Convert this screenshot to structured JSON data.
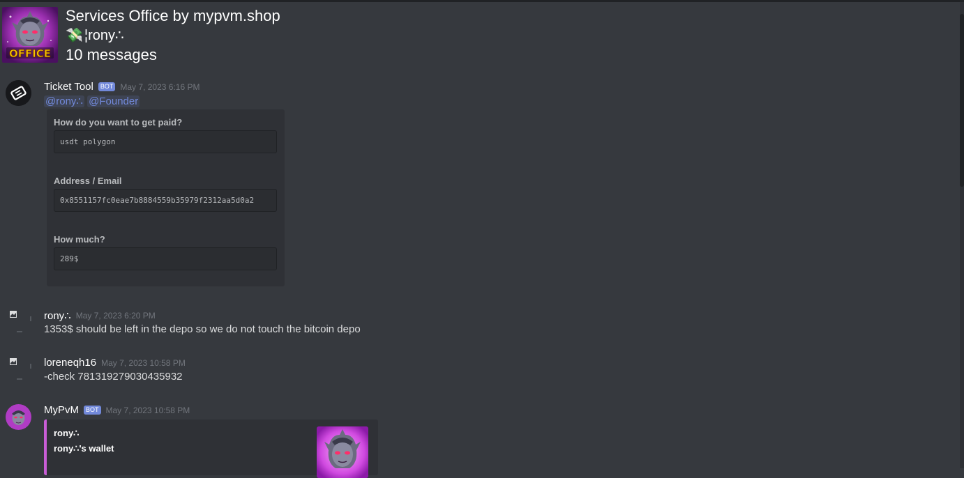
{
  "header": {
    "guild_name": "Services Office by mypvm.shop",
    "channel_emoji": "💸",
    "channel_name": "¦rony∴",
    "message_count": "10 messages",
    "guild_icon_text": "OFFICE"
  },
  "messages": [
    {
      "author": "Ticket Tool",
      "bot_tag": "BOT",
      "timestamp": "May 7, 2023 6:16 PM",
      "mentions": [
        "@rony∴",
        "@Founder"
      ],
      "embed": {
        "fields": [
          {
            "label": "How do you want to get paid?",
            "value": "usdt polygon"
          },
          {
            "label": "Address / Email",
            "value": "0x8551157fc0eae7b8884559b35979f2312aa5d0a2"
          },
          {
            "label": "How much?",
            "value": "289$"
          }
        ]
      }
    },
    {
      "author": "rony∴",
      "timestamp": "May 7, 2023 6:20 PM",
      "content": "1353$ should be left in the depo so we do not touch the bitcoin depo"
    },
    {
      "author": "loreneqh16",
      "timestamp": "May 7, 2023 10:58 PM",
      "content": "-check 781319279030435932"
    },
    {
      "author": "MyPvM",
      "bot_tag": "BOT",
      "timestamp": "May 7, 2023 10:58 PM",
      "embed": {
        "title": "rony∴",
        "subtitle": "rony∴'s wallet",
        "accent_color": "#c95dd6"
      }
    }
  ],
  "colors": {
    "background": "#36393e",
    "bot_tag": "#7289da",
    "mention": "#7289da",
    "embed_bg": "#2f3136",
    "wallet_accent": "#c95dd6"
  }
}
